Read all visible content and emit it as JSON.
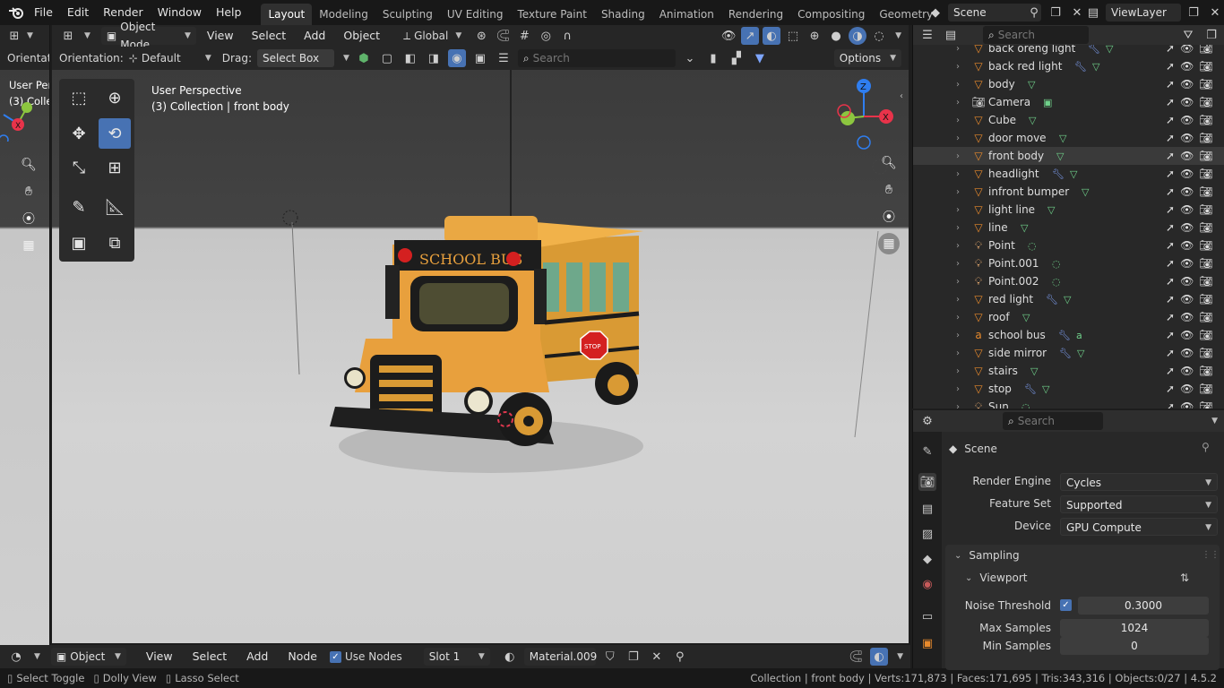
{
  "menu": {
    "items": [
      "File",
      "Edit",
      "Render",
      "Window",
      "Help"
    ]
  },
  "workspaces": {
    "tabs": [
      "Layout",
      "Modeling",
      "Sculpting",
      "UV Editing",
      "Texture Paint",
      "Shading",
      "Animation",
      "Rendering",
      "Compositing",
      "Geometry Node"
    ],
    "active": "Layout"
  },
  "scene_selector": {
    "value": "Scene"
  },
  "viewlayer_selector": {
    "value": "ViewLayer"
  },
  "viewport_header": {
    "mode": "Object Mode",
    "view": "View",
    "select": "Select",
    "add": "Add",
    "object": "Object",
    "transform_orientation": "Global"
  },
  "tool_settings": {
    "orientation_label": "Orientation:",
    "orientation_value": "Default",
    "drag_label": "Drag:",
    "drag_value": "Select Box",
    "search_placeholder": "Search",
    "options_label": "Options"
  },
  "left_strip": {
    "orientation_label": "Orientati",
    "overlay_title": "User Per",
    "overlay_sub": "(3) Colle"
  },
  "viewport_overlay": {
    "title": "User Perspective",
    "subtitle": "(3) Collection | front body"
  },
  "scene_3d": {
    "sign_text": "SCHOOL BUS",
    "stop_text": "STOP"
  },
  "gizmo": {
    "x": "X",
    "y": "Y",
    "z": "Z"
  },
  "outliner": {
    "search_placeholder": "Search",
    "items": [
      {
        "name": "back oreng light",
        "type": "mesh",
        "mods": "wrench,mesh"
      },
      {
        "name": "back red light",
        "type": "mesh",
        "mods": "wrench,mesh"
      },
      {
        "name": "body",
        "type": "mesh",
        "mods": "mesh"
      },
      {
        "name": "Camera",
        "type": "camera",
        "mods": "camera"
      },
      {
        "name": "Cube",
        "type": "mesh",
        "mods": "mesh"
      },
      {
        "name": "door move",
        "type": "mesh",
        "mods": "mesh"
      },
      {
        "name": "front body",
        "type": "mesh",
        "mods": "mesh",
        "selected": true
      },
      {
        "name": "headlight",
        "type": "mesh",
        "mods": "wrench,mesh"
      },
      {
        "name": "infront bumper",
        "type": "mesh",
        "mods": "mesh"
      },
      {
        "name": "light line",
        "type": "mesh",
        "mods": "mesh"
      },
      {
        "name": "line",
        "type": "mesh",
        "mods": "mesh"
      },
      {
        "name": "Point",
        "type": "light",
        "mods": "light"
      },
      {
        "name": "Point.001",
        "type": "light",
        "mods": "light"
      },
      {
        "name": "Point.002",
        "type": "light",
        "mods": "light"
      },
      {
        "name": "red light",
        "type": "mesh",
        "mods": "wrench,mesh"
      },
      {
        "name": "roof",
        "type": "mesh",
        "mods": "mesh"
      },
      {
        "name": "school bus",
        "type": "text",
        "mods": "wrench,text"
      },
      {
        "name": "side mirror",
        "type": "mesh",
        "mods": "wrench,mesh"
      },
      {
        "name": "stairs",
        "type": "mesh",
        "mods": "mesh"
      },
      {
        "name": "stop",
        "type": "mesh",
        "mods": "wrench,mesh"
      },
      {
        "name": "Sun",
        "type": "light",
        "mods": "light"
      }
    ]
  },
  "properties": {
    "search_placeholder": "Search",
    "context": "Scene",
    "render_engine_label": "Render Engine",
    "render_engine_value": "Cycles",
    "feature_set_label": "Feature Set",
    "feature_set_value": "Supported",
    "device_label": "Device",
    "device_value": "GPU Compute",
    "sampling_label": "Sampling",
    "viewport_label": "Viewport",
    "noise_threshold_label": "Noise Threshold",
    "noise_threshold_value": "0.3000",
    "noise_threshold_enabled": true,
    "max_samples_label": "Max Samples",
    "max_samples_value": "1024",
    "min_samples_label": "Min Samples",
    "min_samples_value": "0"
  },
  "node_header": {
    "object": "Object",
    "view": "View",
    "select": "Select",
    "add": "Add",
    "node": "Node",
    "use_nodes_label": "Use Nodes",
    "use_nodes": true,
    "slot": "Slot 1",
    "material": "Material.009"
  },
  "status": {
    "hint1": "Select Toggle",
    "hint2": "Dolly View",
    "hint3": "Lasso Select",
    "stats": "Collection | front body | Verts:171,873 | Faces:171,695 | Tris:343,316 | Objects:0/27 | 4.5.2"
  },
  "colors": {
    "accent": "#4772b3",
    "mesh_icon": "#e88a2c",
    "modifier_icon": "#7d9df0",
    "data_icon": "#6fd08a",
    "bus_yellow": "#e6a33b"
  }
}
